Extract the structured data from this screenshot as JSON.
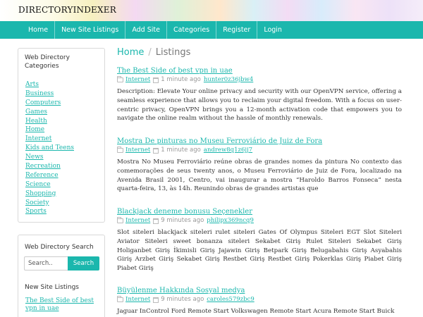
{
  "site": {
    "title": "DIRECTORYINDEXER"
  },
  "nav": {
    "items": [
      {
        "label": "Home"
      },
      {
        "label": "New Site Listings"
      },
      {
        "label": "Add Site"
      },
      {
        "label": "Categories"
      },
      {
        "label": "Register"
      },
      {
        "label": "Login"
      }
    ]
  },
  "sidebar": {
    "categories_title": "Web Directory Categories",
    "categories": [
      "Arts",
      "Business",
      "Computers",
      "Games",
      "Health",
      "Home",
      "Internet",
      "Kids and Teens",
      "News",
      "Recreation",
      "Reference",
      "Science",
      "Shopping",
      "Society",
      "Sports"
    ],
    "search_title": "Web Directory Search",
    "search_placeholder": "Search..",
    "search_button": "Search",
    "new_listings_title": "New Site Listings",
    "new_listings": [
      "The Best Side of best vpn in uae"
    ]
  },
  "breadcrumb": {
    "home": "Home",
    "separator": "/",
    "current": "Listings"
  },
  "listings": [
    {
      "title": "The Best Side of best vpn in uae",
      "category": "Internet",
      "time": "1 minute ago",
      "author": "hunter0z36jbw4",
      "description": "Description: Elevate Your online privacy and security with our OpenVPN service, offering a seamless experience that allows you to reclaim your digital freedom. With a focus on user-centric privacy, OpenVPN brings you a 12-month activation code that empowers you to navigate the online realm without the hassle of monthly renewals."
    },
    {
      "title": "Mostra De pinturas no Museu Ferroviário de Juiz de Fora",
      "category": "Internet",
      "time": "1 minute ago",
      "author": "andrew8q1z6jj7",
      "description": "Mostra No Museu Ferroviário reúne obras de grandes nomes da pintura No contexto das comemorações de seus twenty anos, o Museu Ferroviário de Juiz de Fora, localizado na Avenida Brasil 2001, Centro, vai inaugurar a mostra “Haroldo Barros Fonseca” nesta quarta-feira, 13, às 14h. Reunindo obras de grandes artistas que"
    },
    {
      "title": "Blackjack deneme bonusu Seçenekler",
      "category": "Internet",
      "time": "9 minutes ago",
      "author": "philipx369ncq9",
      "description": "Slot siteleri blackjack siteleri rulet siteleri Gates Of Olympus Siteleri EGT Slot Siteleri Aviator Siteleri sweet bonanza siteleri Sekabet Giriş Rulet Siteleri Sekabet Giriş Holiganbet Giriş İkimisli Giriş Jajawin Giriş Betpark Giriş Belugabahis Giriş Asyabahis Giriş Arzbet Giriş Sekabet Giriş Restbet Giriş Restbet Giriş Pokerklas Giriş Piabet Giriş Piabet Giriş"
    },
    {
      "title": "Büyülenme Hakkında Sosyal medya",
      "category": "Internet",
      "time": "9 minutes ago",
      "author": "caroles579zbc9",
      "description": "Jaguar InControl Ford Remote Start Volkswagen Remote Start Acura Remote Start Buick"
    }
  ]
}
